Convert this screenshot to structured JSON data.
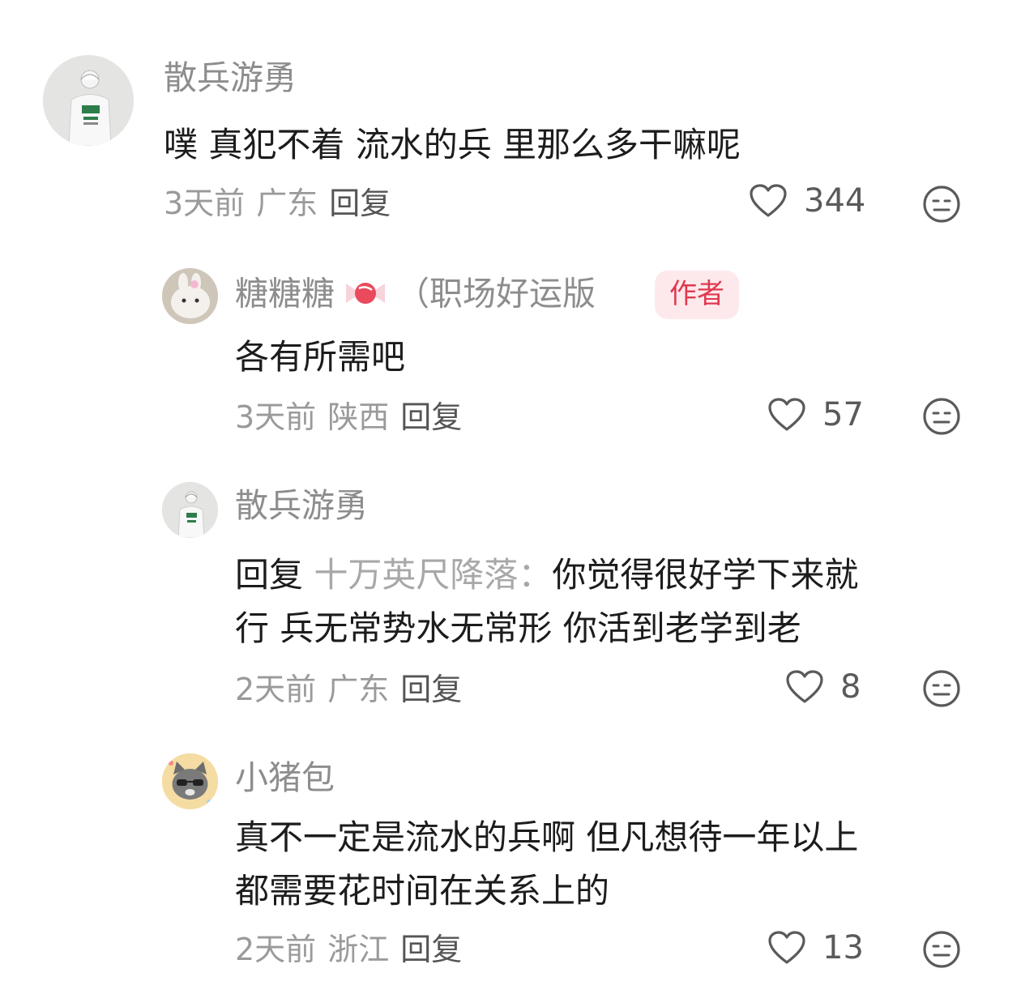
{
  "comments": [
    {
      "username": "散兵游勇",
      "text_lines": [
        "噗 真犯不着 流水的兵 里那么多干嘛呢"
      ],
      "time": "3天前",
      "location": "广东",
      "reply_label": "回复",
      "likes": "344"
    },
    {
      "username": "糖糖糖",
      "username_suffix": "（职场好运版",
      "badge": "作者",
      "text_lines": [
        "各有所需吧"
      ],
      "time": "3天前",
      "location": "陕西",
      "reply_label": "回复",
      "likes": "57"
    },
    {
      "username": "散兵游勇",
      "reply_prefix": "回复",
      "reply_to": "十万英尺降落：",
      "text_line1_rest": "你觉得很好学下来就",
      "text_line2": "行 兵无常势水无常形 你活到老学到老",
      "time": "2天前",
      "location": "广东",
      "reply_label": "回复",
      "likes": "8"
    },
    {
      "username": "小猪包",
      "text_lines": [
        "真不一定是流水的兵啊 但凡想待一年以上",
        "都需要花时间在关系上的"
      ],
      "time": "2天前",
      "location": "浙江",
      "reply_label": "回复",
      "likes": "13"
    }
  ],
  "colors": {
    "username": "#8d8d8d",
    "text": "#1c1c1c",
    "meta": "#9a9a9a",
    "badge_bg": "#fde9ec",
    "badge_text": "#e0394f"
  },
  "icons": {
    "like": "heart-outline-icon",
    "dislike": "meh-face-icon"
  }
}
